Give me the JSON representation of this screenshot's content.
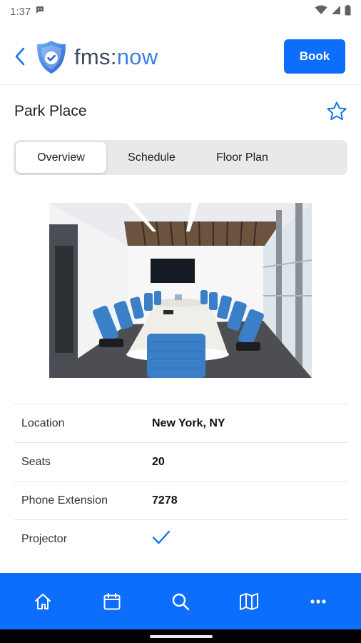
{
  "status_bar": {
    "time": "1:37"
  },
  "header": {
    "logo_prefix": "fms:",
    "logo_suffix": "now",
    "book_label": "Book",
    "brand_color": "#0d6efd"
  },
  "room": {
    "name": "Park Place",
    "favorite": false
  },
  "tabs": [
    {
      "label": "Overview",
      "active": true
    },
    {
      "label": "Schedule",
      "active": false
    },
    {
      "label": "Floor Plan",
      "active": false
    }
  ],
  "details": [
    {
      "label": "Location",
      "value": "New York, NY"
    },
    {
      "label": "Seats",
      "value": "20"
    },
    {
      "label": "Phone Extension",
      "value": "7278"
    },
    {
      "label": "Projector",
      "value": "check-icon"
    }
  ],
  "bottom_nav": [
    {
      "icon": "home-icon"
    },
    {
      "icon": "calendar-icon"
    },
    {
      "icon": "search-icon"
    },
    {
      "icon": "map-icon"
    },
    {
      "icon": "more-icon"
    }
  ]
}
